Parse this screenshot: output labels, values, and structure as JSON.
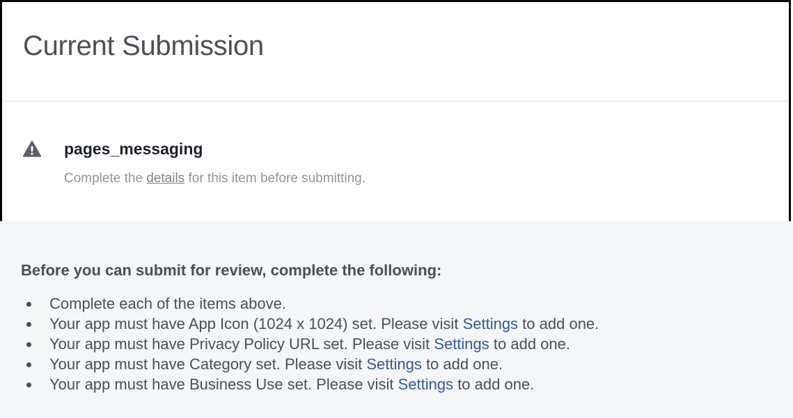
{
  "header": {
    "title": "Current Submission"
  },
  "item": {
    "icon": "warning-triangle-icon",
    "name": "pages_messaging",
    "desc_before": "Complete the ",
    "desc_link": "details",
    "desc_after": " for this item before submitting."
  },
  "requirements": {
    "heading": "Before you can submit for review, complete the following:",
    "items": [
      {
        "before": "Complete each of the items above.",
        "link": "",
        "after": ""
      },
      {
        "before": "Your app must have App Icon (1024 x 1024) set. Please visit ",
        "link": "Settings",
        "after": " to add one."
      },
      {
        "before": "Your app must have Privacy Policy URL set. Please visit ",
        "link": "Settings",
        "after": " to add one."
      },
      {
        "before": "Your app must have Category set. Please visit ",
        "link": "Settings",
        "after": " to add one."
      },
      {
        "before": "Your app must have Business Use set. Please visit ",
        "link": "Settings",
        "after": " to add one."
      }
    ]
  },
  "colors": {
    "title": "#4b4f56",
    "link": "#365899",
    "muted": "#90949c",
    "requirements_bg": "#f5f6f7",
    "warning_icon": "#5a5e66"
  }
}
